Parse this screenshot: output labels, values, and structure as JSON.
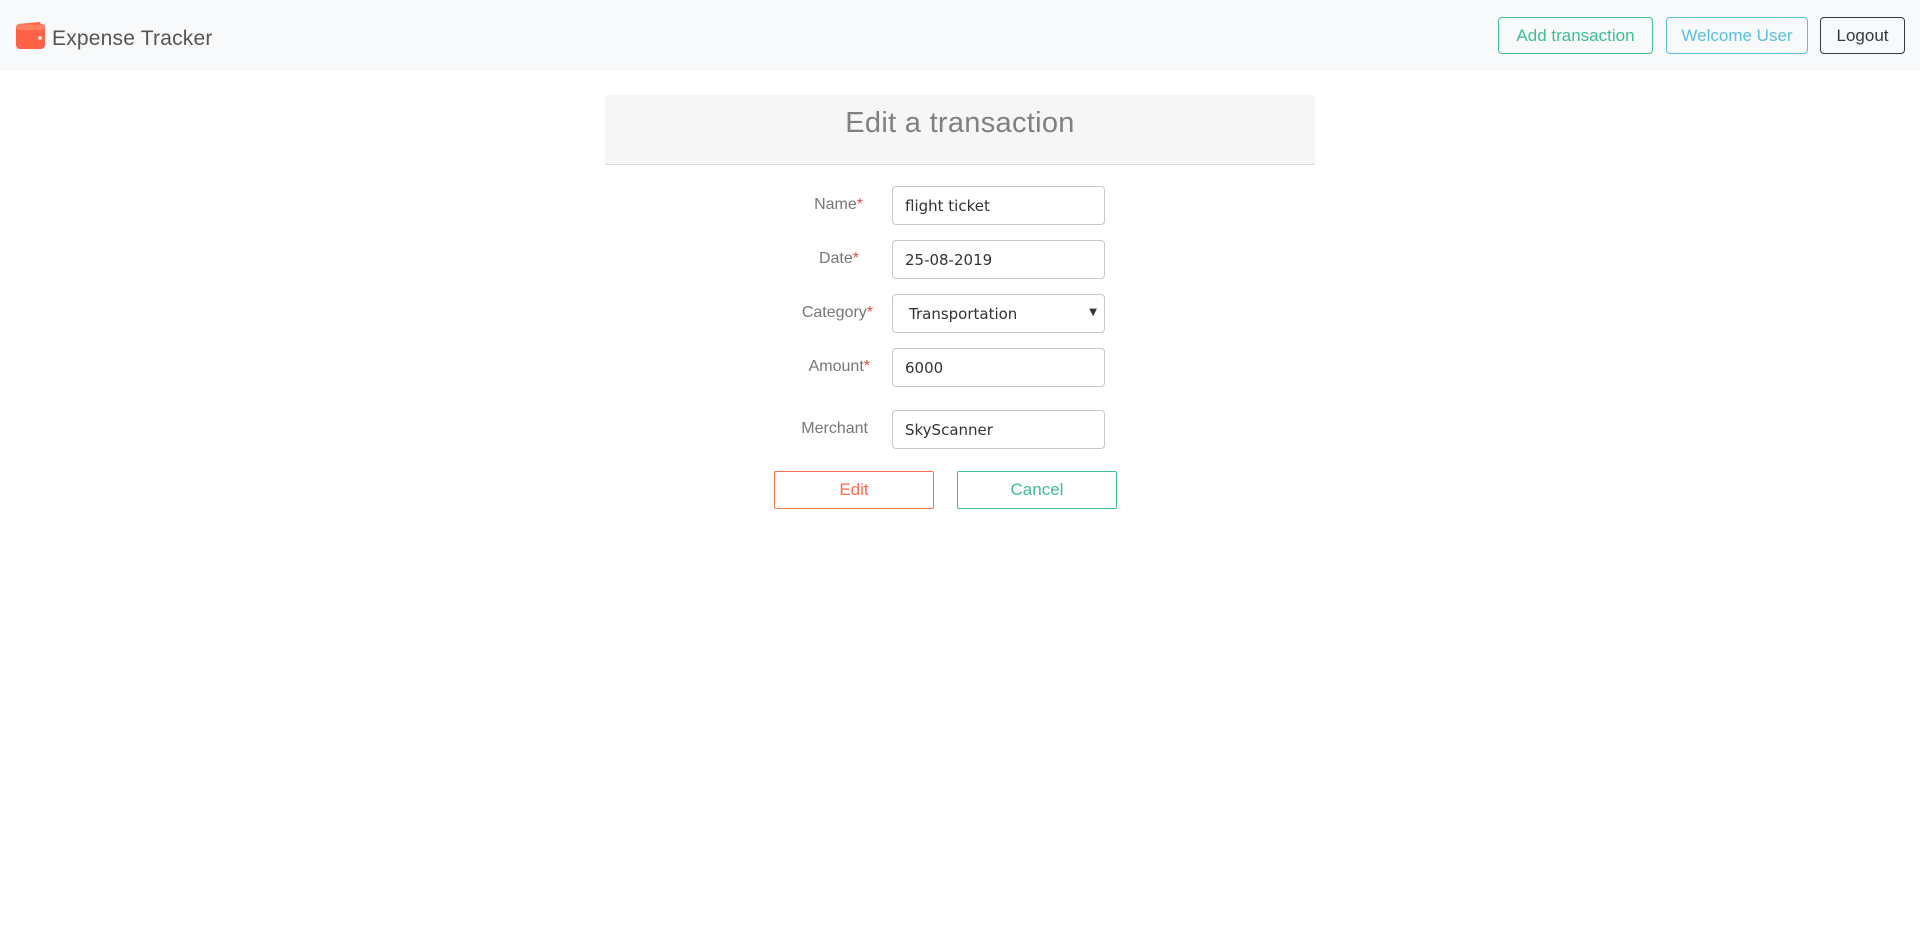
{
  "app": {
    "brand_name": "Expense Tracker",
    "brand_icon": "wallet-icon",
    "accent_color": "#ff6347"
  },
  "nav": {
    "add_transaction_label": "Add transaction",
    "welcome_label": "Welcome User",
    "logout_label": "Logout"
  },
  "form": {
    "title": "Edit a transaction",
    "required_marker": "*",
    "name": {
      "label": "Name",
      "value": "flight ticket"
    },
    "date": {
      "label": "Date",
      "value": "25-08-2019"
    },
    "category": {
      "label": "Category",
      "value": "Transportation"
    },
    "amount": {
      "label": "Amount",
      "value": "6000"
    },
    "merchant": {
      "label": "Merchant",
      "value": "SkyScanner"
    },
    "edit_label": "Edit",
    "cancel_label": "Cancel"
  },
  "colors": {
    "primary_outline": "#ff6e4a",
    "success_outline": "#3fbf8f",
    "info_outline": "#5bc0de",
    "dark_outline": "#343a40",
    "required": "#e74c3c"
  }
}
